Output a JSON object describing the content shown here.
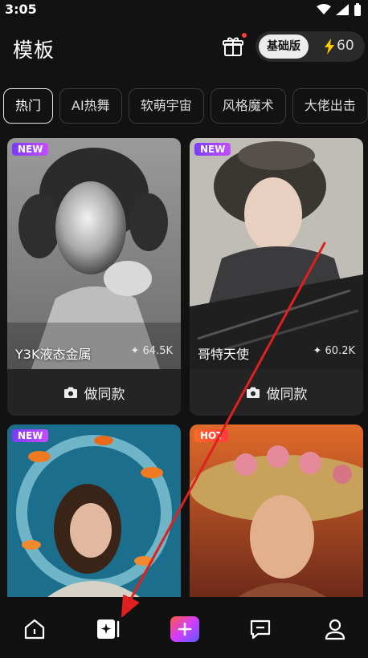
{
  "status": {
    "time": "3:05"
  },
  "header": {
    "title": "模板",
    "plan_label": "基础版",
    "credits": "60"
  },
  "tabs": [
    {
      "label": "热门",
      "active": true
    },
    {
      "label": "AI热舞",
      "active": false
    },
    {
      "label": "软萌宇宙",
      "active": false
    },
    {
      "label": "风格魔术",
      "active": false
    },
    {
      "label": "大佬出击",
      "active": false
    }
  ],
  "cards": [
    {
      "badge": "NEW",
      "name": "Y3K液态金属",
      "likes": "64.5K",
      "button": "做同款"
    },
    {
      "badge": "NEW",
      "name": "哥特天使",
      "likes": "60.2K",
      "button": "做同款"
    },
    {
      "badge": "NEW"
    },
    {
      "badge": "HOT"
    }
  ],
  "nav": [
    "home-icon",
    "templates-icon",
    "create-icon",
    "message-icon",
    "profile-icon"
  ],
  "colors": {
    "accent": "#b14dff",
    "badge_new": "#8a3fff",
    "arrow": "#e02020"
  }
}
